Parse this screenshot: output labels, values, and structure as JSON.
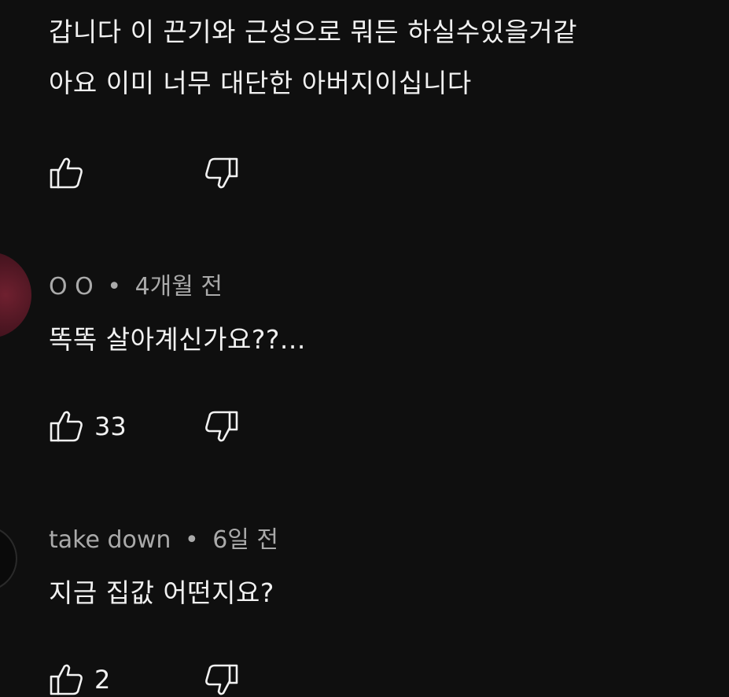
{
  "comments": [
    {
      "line1": "갑니다 이 끈기와 근성으로 뭐든 하실수있을거같",
      "line2": "아요 이미 너무 대단한 아버지이십니다",
      "like_count": ""
    },
    {
      "author": "O O",
      "separator": "•",
      "time": "4개월 전",
      "text": "똑똑 살아계신가요??...",
      "like_count": "33"
    },
    {
      "author": "take down",
      "separator": "•",
      "time": "6일 전",
      "text": "지금 집값 어떤지요?",
      "like_count": "2"
    }
  ],
  "icons": {
    "like": "thumbs-up-icon",
    "dislike": "thumbs-down-icon"
  },
  "colors": {
    "background": "#0f0f0f",
    "text": "#f1f1f1",
    "meta": "#aaaaaa"
  }
}
